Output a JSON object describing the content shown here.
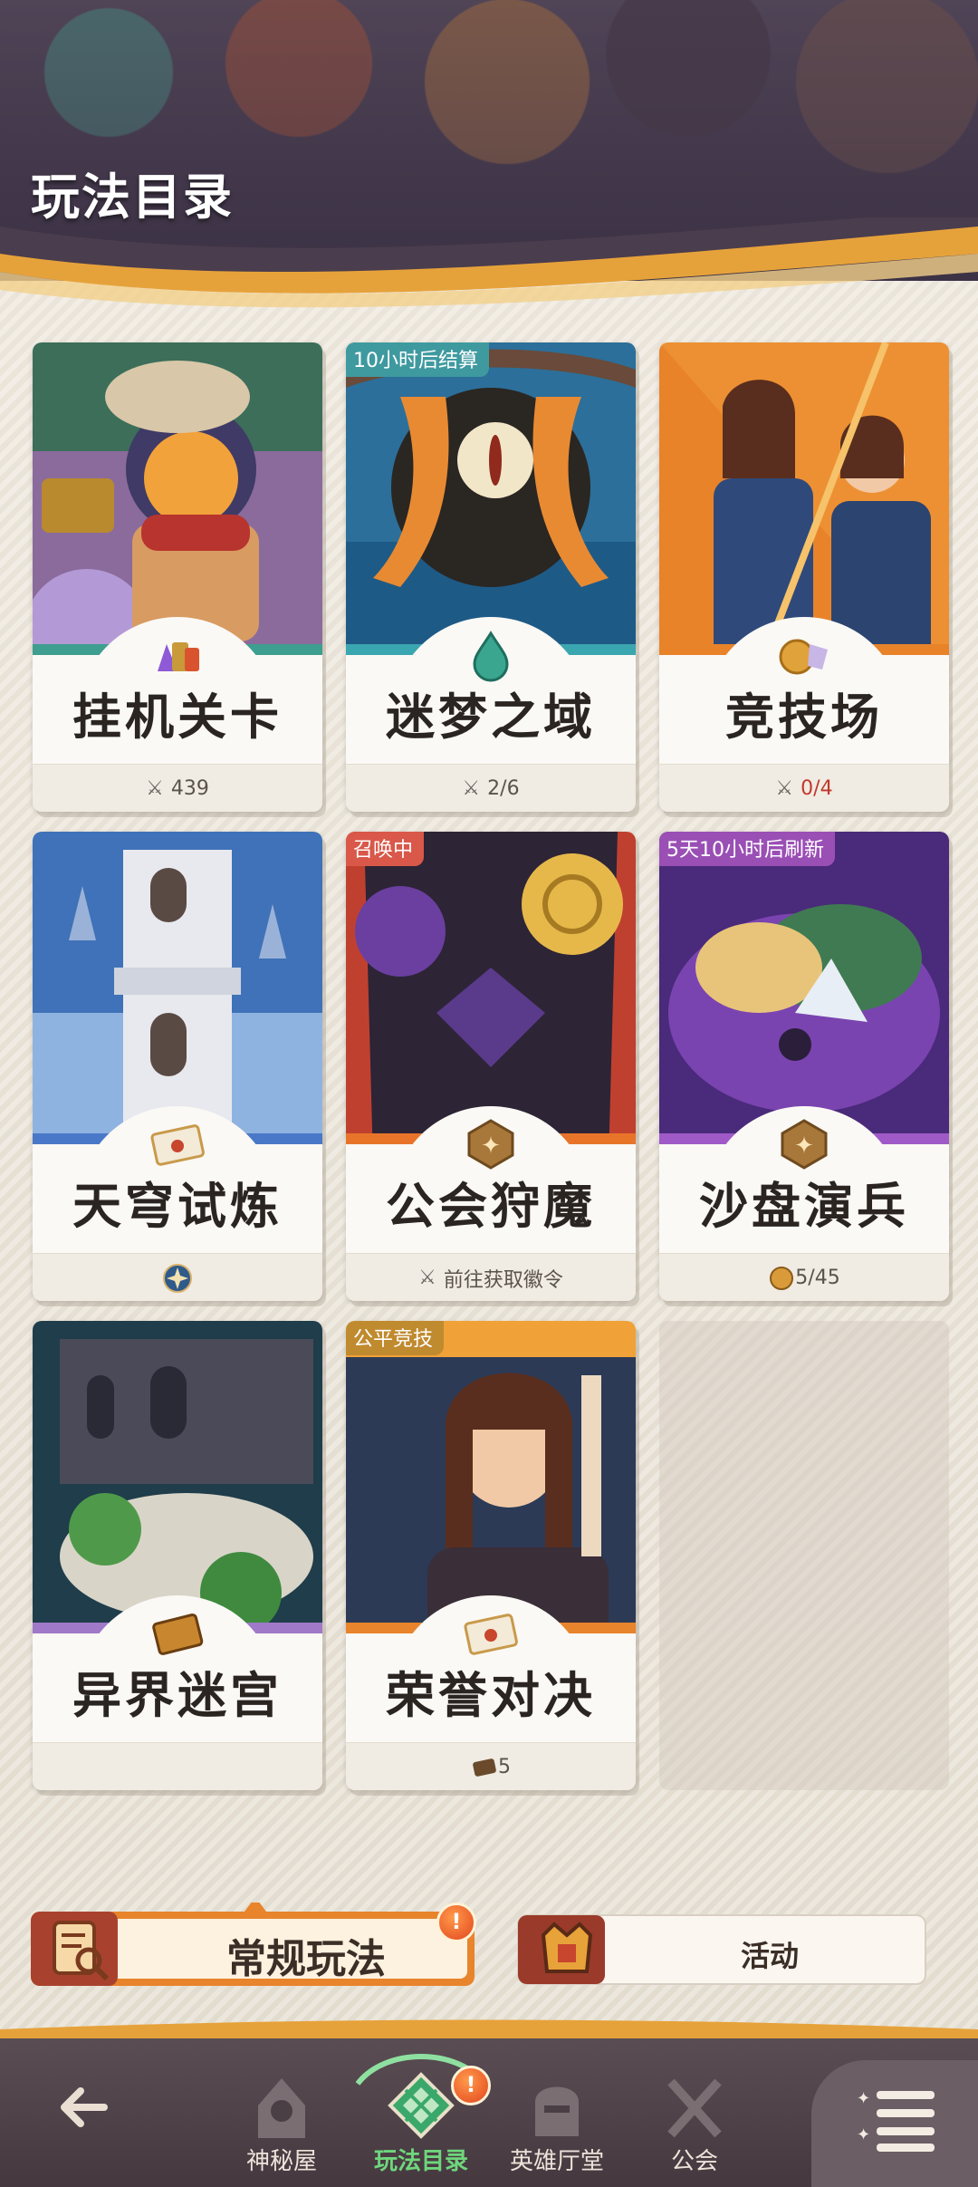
{
  "header": {
    "title": "玩法目录"
  },
  "cards": [
    {
      "name": "挂机关卡",
      "footer": "439",
      "footer_icon": "crossed-swords-icon",
      "tag": ""
    },
    {
      "name": "迷梦之域",
      "footer": "2/6",
      "footer_icon": "crossed-swords-icon",
      "tag": "10小时后结算"
    },
    {
      "name": "竞技场",
      "footer": "0/4",
      "footer_icon": "crossed-swords-icon",
      "tag": ""
    },
    {
      "name": "天穹试炼",
      "footer": "",
      "footer_icon": "star-badge-icon",
      "tag": ""
    },
    {
      "name": "公会狩魔",
      "footer": "前往获取徽令",
      "footer_icon": "crossed-swords-icon",
      "tag": "召唤中"
    },
    {
      "name": "沙盘演兵",
      "footer": "5/45",
      "footer_icon": "coin-icon",
      "tag": "5天10小时后刷新"
    },
    {
      "name": "异界迷宫",
      "footer": "",
      "footer_icon": "",
      "tag": ""
    },
    {
      "name": "荣誉对决",
      "footer": "5",
      "footer_icon": "ticket-icon",
      "tag": "公平竞技"
    }
  ],
  "mode_tabs": [
    {
      "label": "常规玩法",
      "selected": true,
      "icon": "scroll-magnifier-icon",
      "alert": "!"
    },
    {
      "label": "活动",
      "selected": false,
      "icon": "crown-banner-icon"
    }
  ],
  "bottom_nav": [
    {
      "label": "",
      "icon": "back-arrow-icon"
    },
    {
      "label": "神秘屋",
      "icon": "mystery-house-icon"
    },
    {
      "label": "玩法目录",
      "icon": "play-catalog-icon",
      "active": true,
      "alert": "!"
    },
    {
      "label": "英雄厅堂",
      "icon": "hero-helmet-icon"
    },
    {
      "label": "公会",
      "icon": "guild-swords-icon"
    },
    {
      "label": "",
      "icon": "menu-list-icon"
    }
  ],
  "colors": {
    "accent_orange": "#e8842c",
    "active_green": "#6fd67c",
    "tag_teal": "#3f9aa0",
    "tag_red": "#d9584a",
    "tag_purple": "#9a4fb5",
    "tag_gold": "#c08a2f"
  }
}
